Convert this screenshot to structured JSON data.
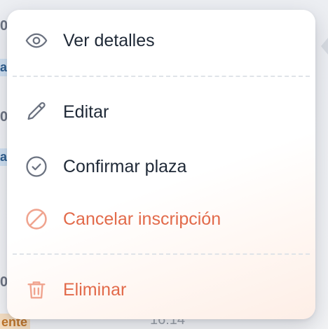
{
  "background": {
    "fragments": [
      {
        "text": "0",
        "style": "num"
      },
      {
        "text": "ac",
        "style": "tag"
      },
      {
        "text": "0",
        "style": "num"
      },
      {
        "text": "ac",
        "style": "tag"
      },
      {
        "text": "0",
        "style": "num"
      },
      {
        "text": "ente",
        "style": "tag-orange"
      }
    ],
    "time_text": "16:14"
  },
  "menu": {
    "items": [
      {
        "label": "Ver detalles",
        "icon": "eye-icon",
        "variant": "default"
      },
      {
        "label": "Editar",
        "icon": "pencil-icon",
        "variant": "default"
      },
      {
        "label": "Confirmar plaza",
        "icon": "check-circle-icon",
        "variant": "default"
      },
      {
        "label": "Cancelar inscripción",
        "icon": "ban-icon",
        "variant": "danger"
      },
      {
        "label": "Eliminar",
        "icon": "trash-icon",
        "variant": "danger"
      }
    ]
  },
  "colors": {
    "text_default": "#1f2937",
    "danger": "#e26a4a",
    "icon_default": "#6b7280",
    "danger_icon": "#f0a48f"
  }
}
